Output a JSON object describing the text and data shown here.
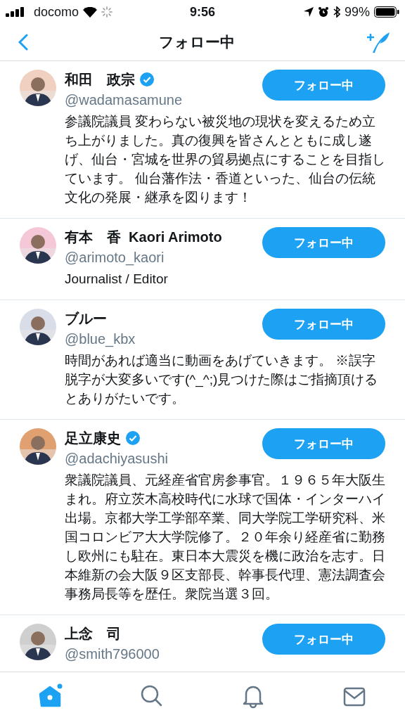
{
  "status_bar": {
    "carrier": "docomo",
    "time": "9:56",
    "battery": "99%"
  },
  "nav": {
    "title": "フォロー中"
  },
  "users": [
    {
      "name": "和田　政宗",
      "verified": true,
      "handle": "@wadamasamune",
      "bio": "参議院議員 変わらない被災地の現状を変えるため立ち上がりました。真の復興を皆さんとともに成し遂げ、仙台・宮城を世界の貿易拠点にすることを目指しています。 仙台藩作法・香道といった、仙台の伝統文化の発展・継承を図ります！",
      "button": "フォロー中"
    },
    {
      "name": "有本　香  Kaori Arimoto",
      "verified": false,
      "handle": "@arimoto_kaori",
      "bio": "Journalist / Editor",
      "button": "フォロー中"
    },
    {
      "name": "ブルー",
      "verified": false,
      "handle": "@blue_kbx",
      "bio": "時間があれば適当に動画をあげていきます。 ※誤字脱字が大変多いです(^_^;)見つけた際はご指摘頂けるとありがたいです。",
      "button": "フォロー中"
    },
    {
      "name": "足立康史",
      "verified": true,
      "handle": "@adachiyasushi",
      "bio": "衆議院議員、元経産省官房参事官。１９６５年大阪生まれ。府立茨木高校時代に水球で国体・インターハイ出場。京都大学工学部卒業、同大学院工学研究科、米国コロンビア大大学院修了。２０年余り経産省に勤務し欧州にも駐在。東日本大震災を機に政治を志す。日本維新の会大阪９区支部長、幹事長代理、憲法調査会事務局長等を歴任。衆院当選３回。",
      "button": "フォロー中"
    },
    {
      "name": "上念　司",
      "verified": false,
      "handle": "@smith796000",
      "button": "フォロー中"
    }
  ],
  "tabs": [
    {
      "kind": "home",
      "selected": true,
      "unread": true
    },
    {
      "kind": "search",
      "selected": false,
      "unread": false
    },
    {
      "kind": "bell",
      "selected": false,
      "unread": false
    },
    {
      "kind": "mail",
      "selected": false,
      "unread": false
    }
  ]
}
